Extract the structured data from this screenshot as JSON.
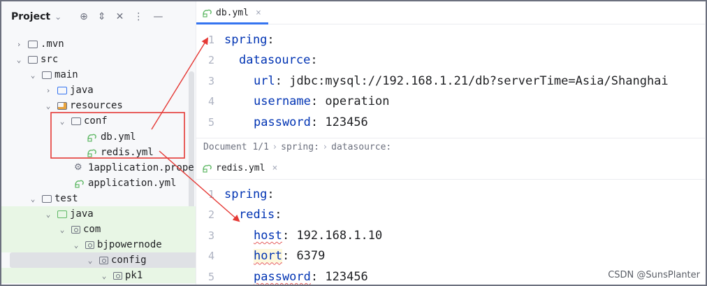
{
  "project_panel": {
    "title": "Project",
    "tree": [
      {
        "label": ".mvn",
        "icon": "folder-icon",
        "arrow": "›"
      },
      {
        "label": "src",
        "icon": "folder-icon",
        "arrow": "⌄"
      },
      {
        "label": "main",
        "icon": "folder-icon",
        "arrow": "⌄"
      },
      {
        "label": "java",
        "icon": "source-folder-icon",
        "arrow": "›"
      },
      {
        "label": "resources",
        "icon": "resources-folder-icon",
        "arrow": "⌄"
      },
      {
        "label": "conf",
        "icon": "folder-icon",
        "arrow": "⌄"
      },
      {
        "label": "db.yml",
        "icon": "yaml-file-icon",
        "arrow": ""
      },
      {
        "label": "redis.yml",
        "icon": "yaml-file-icon",
        "arrow": ""
      },
      {
        "label": "1application.prope",
        "icon": "properties-file-icon",
        "arrow": ""
      },
      {
        "label": "application.yml",
        "icon": "yaml-file-icon",
        "arrow": ""
      },
      {
        "label": "test",
        "icon": "folder-icon",
        "arrow": "⌄"
      },
      {
        "label": "java",
        "icon": "test-folder-icon",
        "arrow": "⌄"
      },
      {
        "label": "com",
        "icon": "package-icon",
        "arrow": "⌄"
      },
      {
        "label": "bjpowernode",
        "icon": "package-icon",
        "arrow": "⌄"
      },
      {
        "label": "config",
        "icon": "package-icon",
        "arrow": "⌄"
      },
      {
        "label": "pk1",
        "icon": "package-icon",
        "arrow": "⌄"
      }
    ]
  },
  "editor_top": {
    "tab_label": "db.yml",
    "lines": [
      {
        "n": "1",
        "key": "spring",
        "value": ""
      },
      {
        "n": "2",
        "key": "datasource",
        "value": ""
      },
      {
        "n": "3",
        "key": "url",
        "value": "jdbc:mysql://192.168.1.21/db?serverTime=Asia/Shanghai"
      },
      {
        "n": "4",
        "key": "username",
        "value": "operation"
      },
      {
        "n": "5",
        "key": "password",
        "value": "123456"
      }
    ],
    "breadcrumb": [
      "Document 1/1",
      "spring:",
      "datasource:"
    ]
  },
  "editor_bottom": {
    "tab_label": "redis.yml",
    "lines": [
      {
        "n": "1",
        "key": "spring",
        "value": ""
      },
      {
        "n": "2",
        "key": "redis",
        "value": ""
      },
      {
        "n": "3",
        "key": "host",
        "value": "192.168.1.10"
      },
      {
        "n": "4",
        "key": "hort",
        "value": "6379"
      },
      {
        "n": "5",
        "key": "password",
        "value": "123456"
      }
    ]
  },
  "colors": {
    "accent": "#3574f0",
    "annotation": "#e53935",
    "yaml_key": "#0033b3"
  },
  "watermark": "CSDN @SunsPlanter"
}
